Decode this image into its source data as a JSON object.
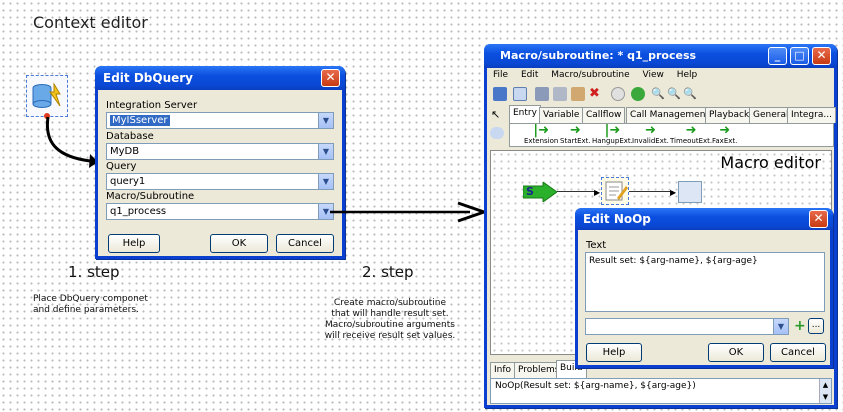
{
  "annotations": {
    "heading": "Context editor",
    "step1": "1. step",
    "step2": "2. step",
    "note1_line1": "Place DbQuery componet",
    "note1_line2": "and define parameters.",
    "note2_line1": "Create macro/subroutine",
    "note2_line2": "that will handle result set.",
    "note2_line3": "Macro/subroutine arguments",
    "note2_line4": "will receive result set values.",
    "macro_editor": "Macro editor"
  },
  "dbquery_dialog": {
    "title": "Edit DbQuery",
    "close": "✕",
    "server_label": "Integration Server",
    "server_value": "MyISserver",
    "database_label": "Database",
    "database_value": "MyDB",
    "query_label": "Query",
    "query_value": "query1",
    "macro_label": "Macro/Subroutine",
    "macro_value": "q1_process",
    "help": "Help",
    "ok": "OK",
    "cancel": "Cancel"
  },
  "macro_window": {
    "title": "Macro/subroutine: * q1_process",
    "menu": [
      "File",
      "Edit",
      "Macro/subroutine",
      "View",
      "Help"
    ],
    "tabs": [
      "Entry",
      "Variable",
      "Callflow",
      "Call Management",
      "Playback",
      "General",
      "Integra..."
    ],
    "palette": [
      "Extension",
      "StartExt.",
      "HangupExt.",
      "InvalidExt.",
      "TimeoutExt.",
      "FaxExt."
    ],
    "start_label": "S",
    "bottom_tabs": [
      "Info",
      "Problems",
      "Build"
    ],
    "bottom_text": "NoOp(Result set: ${arg-name}, ${arg-age})"
  },
  "noop_dialog": {
    "title": "Edit NoOp",
    "close": "✕",
    "text_label": "Text",
    "text_value": "Result set: ${arg-name}, ${arg-age}",
    "help": "Help",
    "ok": "OK",
    "cancel": "Cancel"
  },
  "colors": {
    "xp_title": "#0b4fe0",
    "selection": "#316ac5",
    "arrow_green": "#1a9a1a"
  }
}
